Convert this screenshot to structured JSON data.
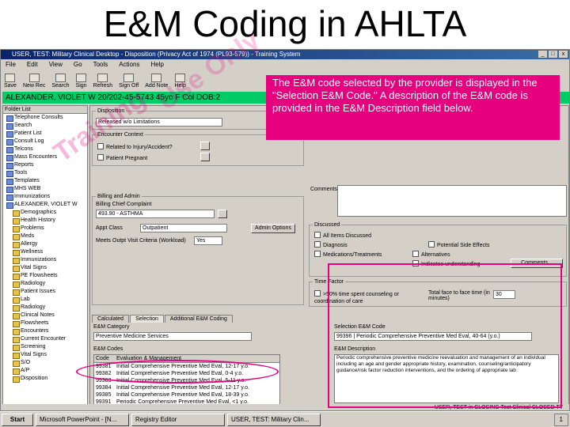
{
  "slide": {
    "title": "E&M Coding in AHLTA"
  },
  "window": {
    "title": "USER, TEST: Military Clinical Desktop - Disposition (Privacy Act of 1974 (PL93-579)) - Training System",
    "controls": [
      "_",
      "□",
      "x"
    ]
  },
  "menu": [
    "File",
    "Edit",
    "View",
    "Go",
    "Tools",
    "Actions",
    "Help"
  ],
  "toolbar": [
    "Save",
    "New Rec",
    "Search",
    "Sign",
    "Refresh",
    "Sign Off",
    "Add Note",
    "Help"
  ],
  "patient": {
    "banner": "ALEXANDER, VIOLET W 20/202-45-5743  45yo  F  Col  DOB:2"
  },
  "folder": {
    "header": "Folder List",
    "items": [
      {
        "label": "Telephone Consults",
        "sub": false
      },
      {
        "label": "Search",
        "sub": false
      },
      {
        "label": "Patient List",
        "sub": false
      },
      {
        "label": "Consult Log",
        "sub": false
      },
      {
        "label": "Telcons",
        "sub": false
      },
      {
        "label": "Mass Encounters",
        "sub": false
      },
      {
        "label": "Reports",
        "sub": false
      },
      {
        "label": "Tools",
        "sub": false
      },
      {
        "label": "Templates",
        "sub": false
      },
      {
        "label": "MHS WEB",
        "sub": false
      },
      {
        "label": "Immunizations",
        "sub": false
      },
      {
        "label": "ALEXANDER, VIOLET W",
        "sub": false
      },
      {
        "label": "Demographics",
        "sub": true
      },
      {
        "label": "Health History",
        "sub": true
      },
      {
        "label": "Problems",
        "sub": true
      },
      {
        "label": "Meds",
        "sub": true
      },
      {
        "label": "Allergy",
        "sub": true
      },
      {
        "label": "Wellness",
        "sub": true
      },
      {
        "label": "Immunizations",
        "sub": true
      },
      {
        "label": "Vital Signs",
        "sub": true
      },
      {
        "label": "PE Flowsheets",
        "sub": true
      },
      {
        "label": "Radiology",
        "sub": true
      },
      {
        "label": "Patient Issues",
        "sub": true
      },
      {
        "label": "Lab",
        "sub": true
      },
      {
        "label": "Radiology",
        "sub": true
      },
      {
        "label": "Clinical Notes",
        "sub": true
      },
      {
        "label": "Flowsheets",
        "sub": true
      },
      {
        "label": "Encounters",
        "sub": true
      },
      {
        "label": "Current Encounter",
        "sub": true
      },
      {
        "label": "Screening",
        "sub": true
      },
      {
        "label": "Vital Signs",
        "sub": true
      },
      {
        "label": "S/O",
        "sub": true
      },
      {
        "label": "A/P",
        "sub": true
      },
      {
        "label": "Disposition",
        "sub": true
      }
    ]
  },
  "disposition": {
    "group_label": "Disposition",
    "value": "Released w/o Limitations",
    "encounter_label": "Encounter Context",
    "check1": "Related to Injury/Accident?",
    "check2": "Patient Pregnant",
    "billing_label": "Billing and Admin",
    "chief_label": "Billing Chief Complaint",
    "chief_value": "493.90 - ASTHMA",
    "appt_label": "Appt Class",
    "appt_value": "Outpatient",
    "admin_btn": "Admin Options",
    "meets_label": "Meets Outpt Visit Criteria (Workload)",
    "meets_value": "Yes"
  },
  "right": {
    "comments_label": "Comments",
    "discussed_label": "Discussed",
    "discussed_items": [
      "All Items Discussed",
      "Diagnosis",
      "Medications/Treatments",
      "Alternatives",
      "Potential Side Effects",
      "Indicates understanding"
    ],
    "comments_btn": "Comments...",
    "time_label": "Time Factor",
    "time_check": ">50% time spent counseling or coordination of care",
    "face_label": "Total face to face time (in minutes)",
    "face_value": "30"
  },
  "tabs": [
    "Calculated",
    "Selection",
    "Additional E&M Coding"
  ],
  "em": {
    "category_label": "E&M Category",
    "category_value": "Preventive Medicine Services",
    "codes_label": "E&M Codes",
    "columns": [
      "Code",
      "Evaluation & Management"
    ],
    "rows": [
      {
        "code": "99381",
        "desc": "Initial Comprehensive Preventive Med Eval, 12-17 y.o.",
        "sel": false
      },
      {
        "code": "99382",
        "desc": "Initial Comprehensive Preventive Med Eval, 0-4 y.o.",
        "sel": false
      },
      {
        "code": "99383",
        "desc": "Initial Comprehensive Preventive Med Eval, 5-11 y.o.",
        "sel": false
      },
      {
        "code": "99384",
        "desc": "Initial Comprehensive Preventive Med Eval, 12-17 y.o.",
        "sel": false
      },
      {
        "code": "99385",
        "desc": "Initial Comprehensive Preventive Med Eval, 18-39 y.o.",
        "sel": false
      },
      {
        "code": "99391",
        "desc": "Periodic Comprehensive Preventive Med Eval, <1 y.o.",
        "sel": false
      },
      {
        "code": "99392",
        "desc": "Periodic Comprehensive Preventive Med Eval, 1-4 y.o.",
        "sel": false
      },
      {
        "code": "99393",
        "desc": "Periodic Comprehensive Preventive Med Eval, 5-11 y.o.",
        "sel": false
      },
      {
        "code": "99394",
        "desc": "Periodic Comprehensive Preventive Med Eval, 12-17 y.o.",
        "sel": false
      },
      {
        "code": "99395",
        "desc": "Periodic Comprehensive Preventive Med Eval, 18-39 y.o.",
        "sel": false
      },
      {
        "code": "99396",
        "desc": "Periodic Comprehensive Preventive Med Eval, 40-64 y.o.",
        "sel": true
      }
    ],
    "selection_label": "Selection E&M Code",
    "selection_value": "99396 | Periodic Comprehensive Preventive Med Eval, 40-64 (y.o.)",
    "description_label": "E&M Description",
    "description_text": "Periodic comprehensive preventive medicine reevaluation and management of an individual including an age and gender appropriate history, examination, counseling/anticipatory guidance/risk factor reduction interventions, and the ordering of appropriate lab"
  },
  "callout": {
    "text": "The E&M code selected by the provider is displayed in the \"Selection E&M Code.\" A description of the E&M code is provided in the E&M Description field below."
  },
  "watermark": {
    "text1": "Training",
    "text2": "Use Only"
  },
  "status": {
    "text": "USER, TEST  in CLOSING  Test Clinical CLOSED  TT"
  },
  "taskbar": {
    "start": "Start",
    "tasks": [
      "Microsoft PowerPoint - [N...",
      "Registry Editor",
      "USER, TEST: Military Clin..."
    ],
    "clock": "1"
  }
}
